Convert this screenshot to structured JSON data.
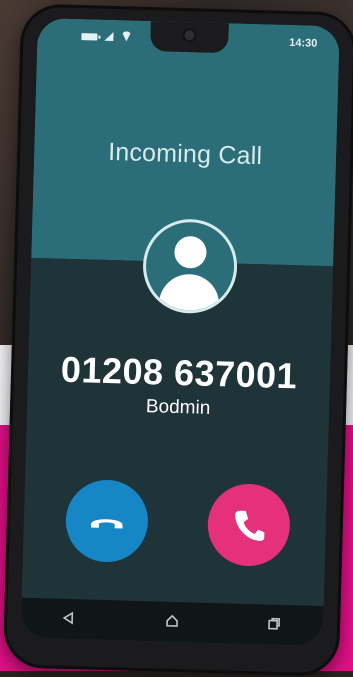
{
  "status_bar": {
    "time": "14:30"
  },
  "call": {
    "title": "Incoming Call",
    "number": "01208 637001",
    "location": "Bodmin"
  },
  "buttons": {
    "decline": {
      "icon": "phone-hangup-icon",
      "color": "#1786c7"
    },
    "answer": {
      "icon": "phone-icon",
      "color": "#e5307a"
    }
  },
  "nav_bar": {
    "icons": [
      "back-icon",
      "home-icon",
      "recents-icon"
    ]
  },
  "colors": {
    "screen_top": "#2b6e79",
    "screen_bottom": "#1f3439",
    "background_pink": "#e20f87"
  }
}
